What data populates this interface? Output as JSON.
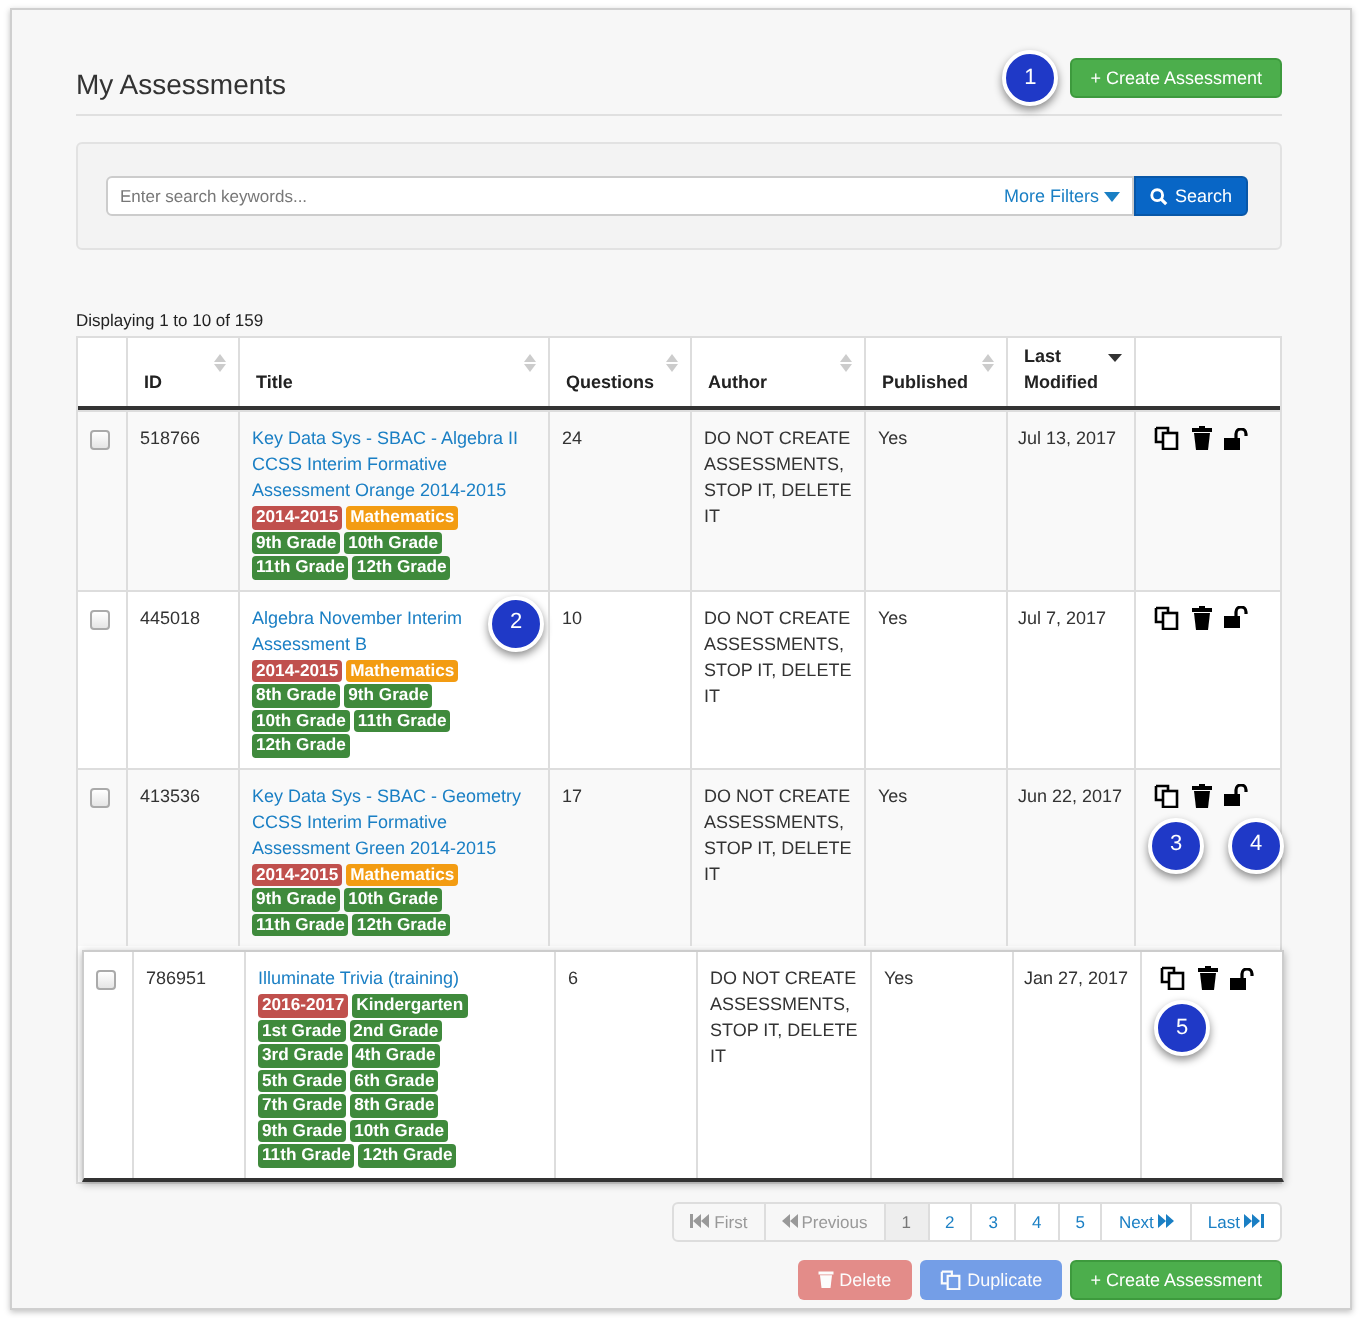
{
  "header": {
    "title": "My Assessments",
    "create_button": "+ Create Assessment",
    "callout": "1"
  },
  "search": {
    "placeholder": "Enter search keywords...",
    "more_filters": "More Filters",
    "button": "Search"
  },
  "summary": "Displaying 1 to 10 of 159",
  "table": {
    "columns": [
      {
        "sortable": false,
        "kind": "check"
      },
      {
        "label": "ID",
        "sortable": true,
        "kind": "text"
      },
      {
        "label": "Title",
        "sortable": true,
        "kind": "text"
      },
      {
        "label": "Questions",
        "sortable": true,
        "kind": "text"
      },
      {
        "label": "Author",
        "sortable": true,
        "kind": "text"
      },
      {
        "label": "Published",
        "sortable": true,
        "kind": "text"
      },
      {
        "label": "Last Modified",
        "sortable": true,
        "sorted_desc": true,
        "kind": "text"
      },
      {
        "sortable": false,
        "kind": "actions"
      }
    ],
    "rows": [
      {
        "checked": false,
        "raised": false,
        "id": "518766",
        "title": "Key Data Sys - SBAC - Algebra II CCSS Interim Formative Assessment Orange 2014-2015",
        "tags": [
          {
            "label": "2014-2015",
            "color": "#c0504d"
          },
          {
            "label": "Mathematics",
            "color": "#f39c12"
          },
          {
            "label": "9th Grade",
            "color": "#3f8a3c"
          },
          {
            "label": "10th Grade",
            "color": "#3f8a3c"
          },
          {
            "label": "11th Grade",
            "color": "#3f8a3c"
          },
          {
            "label": "12th Grade",
            "color": "#3f8a3c"
          }
        ],
        "questions": "24",
        "author": "DO NOT CREATE ASSESSMENTS, STOP IT, DELETE IT",
        "published": "Yes",
        "modified": "Jul 13, 2017"
      },
      {
        "checked": false,
        "raised": false,
        "id": "445018",
        "title": "Algebra November Interim Assessment B",
        "title_callout": "2",
        "tags": [
          {
            "label": "2014-2015",
            "color": "#c0504d"
          },
          {
            "label": "Mathematics",
            "color": "#f39c12"
          },
          {
            "label": "8th Grade",
            "color": "#3f8a3c"
          },
          {
            "label": "9th Grade",
            "color": "#3f8a3c"
          },
          {
            "label": "10th Grade",
            "color": "#3f8a3c"
          },
          {
            "label": "11th Grade",
            "color": "#3f8a3c"
          },
          {
            "label": "12th Grade",
            "color": "#3f8a3c"
          }
        ],
        "questions": "10",
        "author": "DO NOT CREATE ASSESSMENTS, STOP IT, DELETE IT",
        "published": "Yes",
        "modified": "Jul 7, 2017"
      },
      {
        "checked": false,
        "raised": false,
        "id": "413536",
        "title": "Key Data Sys - SBAC - Geometry CCSS Interim Formative Assessment Green 2014-2015",
        "tags": [
          {
            "label": "2014-2015",
            "color": "#c0504d"
          },
          {
            "label": "Mathematics",
            "color": "#f39c12"
          },
          {
            "label": "9th Grade",
            "color": "#3f8a3c"
          },
          {
            "label": "10th Grade",
            "color": "#3f8a3c"
          },
          {
            "label": "11th Grade",
            "color": "#3f8a3c"
          },
          {
            "label": "12th Grade",
            "color": "#3f8a3c"
          }
        ],
        "questions": "17",
        "author": "DO NOT CREATE ASSESSMENTS, STOP IT, DELETE IT",
        "published": "Yes",
        "modified": "Jun 22, 2017",
        "callouts": [
          "3",
          "4"
        ]
      },
      {
        "checked": false,
        "raised": true,
        "id": "786951",
        "title": "Illuminate Trivia (training)",
        "tags": [
          {
            "label": "2016-2017",
            "color": "#c0504d"
          },
          {
            "label": "Kindergarten",
            "color": "#3f8a3c"
          },
          {
            "label": "1st Grade",
            "color": "#3f8a3c"
          },
          {
            "label": "2nd Grade",
            "color": "#3f8a3c"
          },
          {
            "label": "3rd Grade",
            "color": "#3f8a3c"
          },
          {
            "label": "4th Grade",
            "color": "#3f8a3c"
          },
          {
            "label": "5th Grade",
            "color": "#3f8a3c"
          },
          {
            "label": "6th Grade",
            "color": "#3f8a3c"
          },
          {
            "label": "7th Grade",
            "color": "#3f8a3c"
          },
          {
            "label": "8th Grade",
            "color": "#3f8a3c"
          },
          {
            "label": "9th Grade",
            "color": "#3f8a3c"
          },
          {
            "label": "10th Grade",
            "color": "#3f8a3c"
          },
          {
            "label": "11th Grade",
            "color": "#3f8a3c"
          },
          {
            "label": "12th Grade",
            "color": "#3f8a3c"
          }
        ],
        "questions": "6",
        "author": "DO NOT CREATE ASSESSMENTS, STOP IT, DELETE IT",
        "published": "Yes",
        "modified": "Jan 27, 2017",
        "callouts": [
          "5"
        ]
      }
    ]
  },
  "pagination": [
    {
      "label": "First",
      "kind": "first",
      "disabled": true,
      "selected": false
    },
    {
      "label": "Previous",
      "kind": "prev",
      "disabled": true,
      "selected": false
    },
    {
      "label": "1",
      "kind": "page",
      "disabled": false,
      "selected": true
    },
    {
      "label": "2",
      "kind": "page",
      "disabled": false,
      "selected": false
    },
    {
      "label": "3",
      "kind": "page",
      "disabled": false,
      "selected": false
    },
    {
      "label": "4",
      "kind": "page",
      "disabled": false,
      "selected": false
    },
    {
      "label": "5",
      "kind": "page",
      "disabled": false,
      "selected": false
    },
    {
      "label": "Next",
      "kind": "next",
      "disabled": false,
      "selected": false
    },
    {
      "label": "Last",
      "kind": "last",
      "disabled": false,
      "selected": false
    }
  ],
  "footer_buttons": [
    {
      "label": "Delete",
      "kind": "delete",
      "disabled": true
    },
    {
      "label": "Duplicate",
      "kind": "duplicate",
      "disabled": true
    },
    {
      "label": "+ Create Assessment",
      "kind": "create",
      "disabled": false
    }
  ]
}
